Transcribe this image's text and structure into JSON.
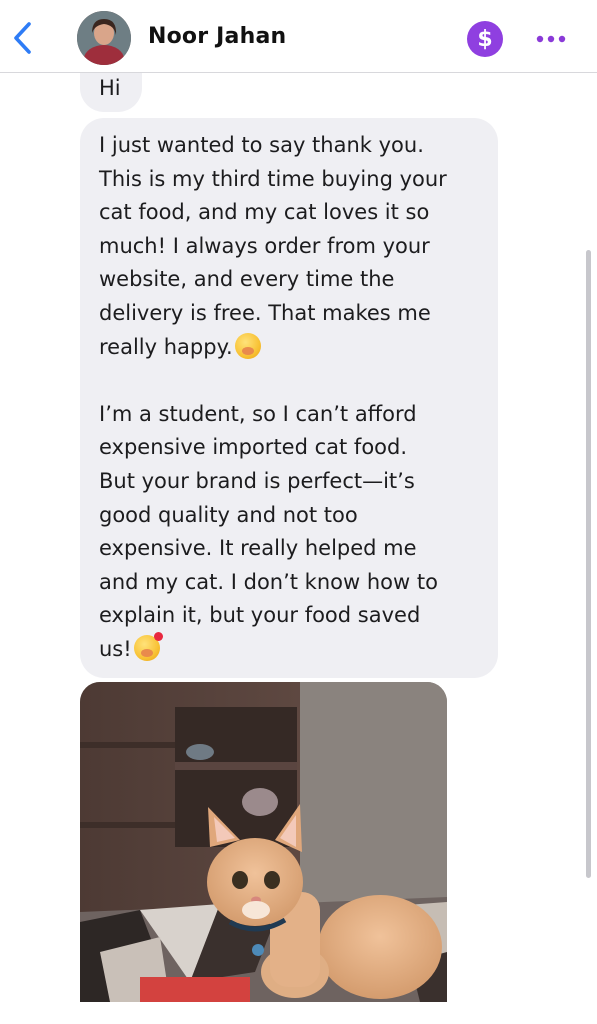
{
  "header": {
    "back_icon": "chevron-left-icon",
    "contact_name": "Noor Jahan",
    "pay_icon": "dollar-icon",
    "pay_symbol": "$",
    "more_icon": "more-horizontal-icon"
  },
  "messages": {
    "greeting": "Hi",
    "long_lines_p1": [
      "I just wanted to say thank you.",
      "This is my third time buying your",
      "cat food, and my cat loves it so",
      "much! I always order from your",
      "website, and every time the",
      "delivery is free. That makes me",
      "really happy."
    ],
    "long_lines_p2": [
      "I’m a student, so I can’t afford",
      "expensive imported cat food.",
      "But your brand is perfect—it’s",
      "good quality and not too",
      "expensive. It really helped me",
      "and my cat. I don’t know how to",
      "explain it, but your food saved",
      "us!"
    ],
    "emoji_1": "hand-over-mouth-emoji",
    "emoji_2": "smiling-face-with-hearts-emoji"
  },
  "photo": {
    "subject": "cat-photo"
  },
  "colors": {
    "accent_blue": "#2e7cf6",
    "pay_purple": "#8f3fe0",
    "bubble_gray": "#efeff3",
    "more_purple": "#8a3ad8"
  }
}
